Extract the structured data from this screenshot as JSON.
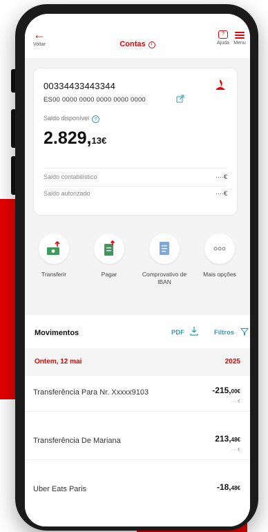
{
  "header": {
    "back_label": "Voltar",
    "title": "Contas",
    "help_label": "Ajuda",
    "menu_label": "Menu"
  },
  "account": {
    "number": "00334433443344",
    "iban": "ES00 0000 0000 0000 0000 0000",
    "available_label": "Saldo disponível",
    "balance_int": "2.829,",
    "balance_dec": "13€",
    "accounting_label": "Saldo contabilístico",
    "accounting_value": "····€",
    "authorized_label": "Saldo autorizado",
    "authorized_value": "····€"
  },
  "actions": [
    {
      "label": "Transferir"
    },
    {
      "label": "Pagar"
    },
    {
      "label": "Comprovativo de IBAN"
    },
    {
      "label": "Mais opções"
    }
  ],
  "movements": {
    "title": "Movimentos",
    "pdf_label": "PDF",
    "filter_label": "Filtros",
    "date_left": "Ontem, 12 mai",
    "date_right": "2025",
    "items": [
      {
        "description": "Transferência Para Nr. Xxxxx9103",
        "amount": "-215,",
        "amount_dec": "00€",
        "sub": "····€"
      },
      {
        "description": "Transferência De Mariana",
        "amount": "213,",
        "amount_dec": "48€",
        "sub": "····€"
      },
      {
        "description": "Uber Eats Paris",
        "amount": "-18,",
        "amount_dec": "48€",
        "sub": ""
      }
    ]
  },
  "colors": {
    "accent": "#e60000",
    "link": "#2f9fb7",
    "action_green": "#3d9a5a"
  }
}
